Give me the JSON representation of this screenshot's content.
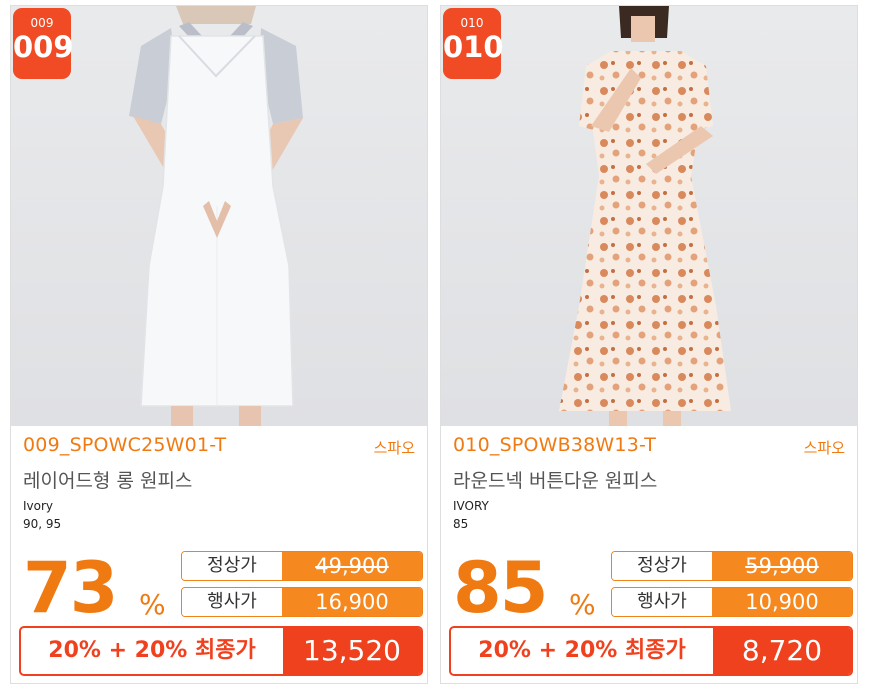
{
  "products": [
    {
      "badge_small": "009",
      "badge_big": "009",
      "code": "009_SPOWC25W01-T",
      "brand": "스파오",
      "name": "레이어드형 롱 원피스",
      "color": "Ivory",
      "sizes": "90, 95",
      "discount": "73",
      "percent_sign": "%",
      "regular_label": "정상가",
      "regular_price": "49,900",
      "event_label": "행사가",
      "event_price": "16,900",
      "final_label": "20% + 20% 최종가",
      "final_price": "13,520",
      "photo": "white-layered-long-dress"
    },
    {
      "badge_small": "010",
      "badge_big": "010",
      "code": "010_SPOWB38W13-T",
      "brand": "스파오",
      "name": "라운드넥 버튼다운 원피스",
      "color": "IVORY",
      "sizes": "85",
      "discount": "85",
      "percent_sign": "%",
      "regular_label": "정상가",
      "regular_price": "59,900",
      "event_label": "행사가",
      "event_price": "10,900",
      "final_label": "20% + 20% 최종가",
      "final_price": "8,720",
      "photo": "floral-button-down-dress"
    }
  ],
  "colors": {
    "accent_orange": "#f07a12",
    "price_orange": "#f5881f",
    "final_red": "#f0411e",
    "badge_red": "#f04b24"
  }
}
